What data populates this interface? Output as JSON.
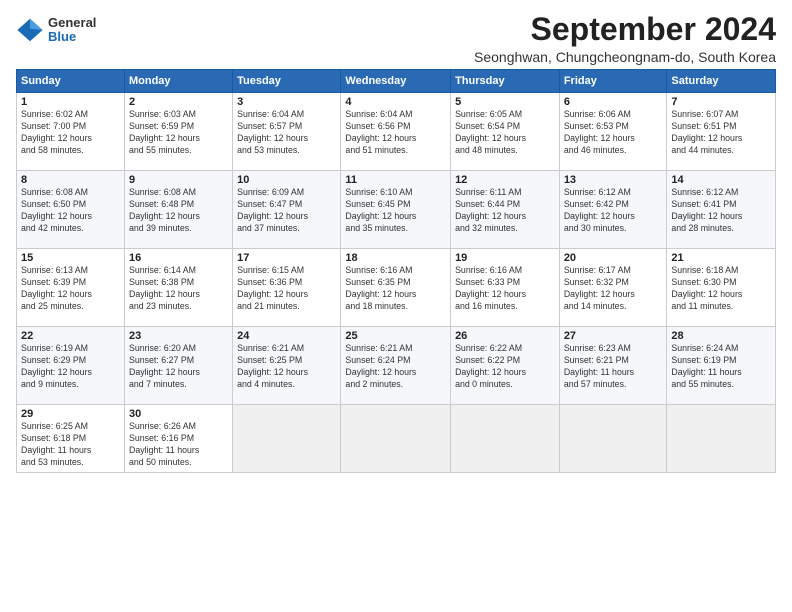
{
  "logo": {
    "general": "General",
    "blue": "Blue"
  },
  "title": "September 2024",
  "location": "Seonghwan, Chungcheongnam-do, South Korea",
  "days_header": [
    "Sunday",
    "Monday",
    "Tuesday",
    "Wednesday",
    "Thursday",
    "Friday",
    "Saturday"
  ],
  "weeks": [
    [
      {
        "day": "1",
        "info": "Sunrise: 6:02 AM\nSunset: 7:00 PM\nDaylight: 12 hours\nand 58 minutes."
      },
      {
        "day": "2",
        "info": "Sunrise: 6:03 AM\nSunset: 6:59 PM\nDaylight: 12 hours\nand 55 minutes."
      },
      {
        "day": "3",
        "info": "Sunrise: 6:04 AM\nSunset: 6:57 PM\nDaylight: 12 hours\nand 53 minutes."
      },
      {
        "day": "4",
        "info": "Sunrise: 6:04 AM\nSunset: 6:56 PM\nDaylight: 12 hours\nand 51 minutes."
      },
      {
        "day": "5",
        "info": "Sunrise: 6:05 AM\nSunset: 6:54 PM\nDaylight: 12 hours\nand 48 minutes."
      },
      {
        "day": "6",
        "info": "Sunrise: 6:06 AM\nSunset: 6:53 PM\nDaylight: 12 hours\nand 46 minutes."
      },
      {
        "day": "7",
        "info": "Sunrise: 6:07 AM\nSunset: 6:51 PM\nDaylight: 12 hours\nand 44 minutes."
      }
    ],
    [
      {
        "day": "8",
        "info": "Sunrise: 6:08 AM\nSunset: 6:50 PM\nDaylight: 12 hours\nand 42 minutes."
      },
      {
        "day": "9",
        "info": "Sunrise: 6:08 AM\nSunset: 6:48 PM\nDaylight: 12 hours\nand 39 minutes."
      },
      {
        "day": "10",
        "info": "Sunrise: 6:09 AM\nSunset: 6:47 PM\nDaylight: 12 hours\nand 37 minutes."
      },
      {
        "day": "11",
        "info": "Sunrise: 6:10 AM\nSunset: 6:45 PM\nDaylight: 12 hours\nand 35 minutes."
      },
      {
        "day": "12",
        "info": "Sunrise: 6:11 AM\nSunset: 6:44 PM\nDaylight: 12 hours\nand 32 minutes."
      },
      {
        "day": "13",
        "info": "Sunrise: 6:12 AM\nSunset: 6:42 PM\nDaylight: 12 hours\nand 30 minutes."
      },
      {
        "day": "14",
        "info": "Sunrise: 6:12 AM\nSunset: 6:41 PM\nDaylight: 12 hours\nand 28 minutes."
      }
    ],
    [
      {
        "day": "15",
        "info": "Sunrise: 6:13 AM\nSunset: 6:39 PM\nDaylight: 12 hours\nand 25 minutes."
      },
      {
        "day": "16",
        "info": "Sunrise: 6:14 AM\nSunset: 6:38 PM\nDaylight: 12 hours\nand 23 minutes."
      },
      {
        "day": "17",
        "info": "Sunrise: 6:15 AM\nSunset: 6:36 PM\nDaylight: 12 hours\nand 21 minutes."
      },
      {
        "day": "18",
        "info": "Sunrise: 6:16 AM\nSunset: 6:35 PM\nDaylight: 12 hours\nand 18 minutes."
      },
      {
        "day": "19",
        "info": "Sunrise: 6:16 AM\nSunset: 6:33 PM\nDaylight: 12 hours\nand 16 minutes."
      },
      {
        "day": "20",
        "info": "Sunrise: 6:17 AM\nSunset: 6:32 PM\nDaylight: 12 hours\nand 14 minutes."
      },
      {
        "day": "21",
        "info": "Sunrise: 6:18 AM\nSunset: 6:30 PM\nDaylight: 12 hours\nand 11 minutes."
      }
    ],
    [
      {
        "day": "22",
        "info": "Sunrise: 6:19 AM\nSunset: 6:29 PM\nDaylight: 12 hours\nand 9 minutes."
      },
      {
        "day": "23",
        "info": "Sunrise: 6:20 AM\nSunset: 6:27 PM\nDaylight: 12 hours\nand 7 minutes."
      },
      {
        "day": "24",
        "info": "Sunrise: 6:21 AM\nSunset: 6:25 PM\nDaylight: 12 hours\nand 4 minutes."
      },
      {
        "day": "25",
        "info": "Sunrise: 6:21 AM\nSunset: 6:24 PM\nDaylight: 12 hours\nand 2 minutes."
      },
      {
        "day": "26",
        "info": "Sunrise: 6:22 AM\nSunset: 6:22 PM\nDaylight: 12 hours\nand 0 minutes."
      },
      {
        "day": "27",
        "info": "Sunrise: 6:23 AM\nSunset: 6:21 PM\nDaylight: 11 hours\nand 57 minutes."
      },
      {
        "day": "28",
        "info": "Sunrise: 6:24 AM\nSunset: 6:19 PM\nDaylight: 11 hours\nand 55 minutes."
      }
    ],
    [
      {
        "day": "29",
        "info": "Sunrise: 6:25 AM\nSunset: 6:18 PM\nDaylight: 11 hours\nand 53 minutes."
      },
      {
        "day": "30",
        "info": "Sunrise: 6:26 AM\nSunset: 6:16 PM\nDaylight: 11 hours\nand 50 minutes."
      },
      {
        "day": "",
        "info": ""
      },
      {
        "day": "",
        "info": ""
      },
      {
        "day": "",
        "info": ""
      },
      {
        "day": "",
        "info": ""
      },
      {
        "day": "",
        "info": ""
      }
    ]
  ]
}
